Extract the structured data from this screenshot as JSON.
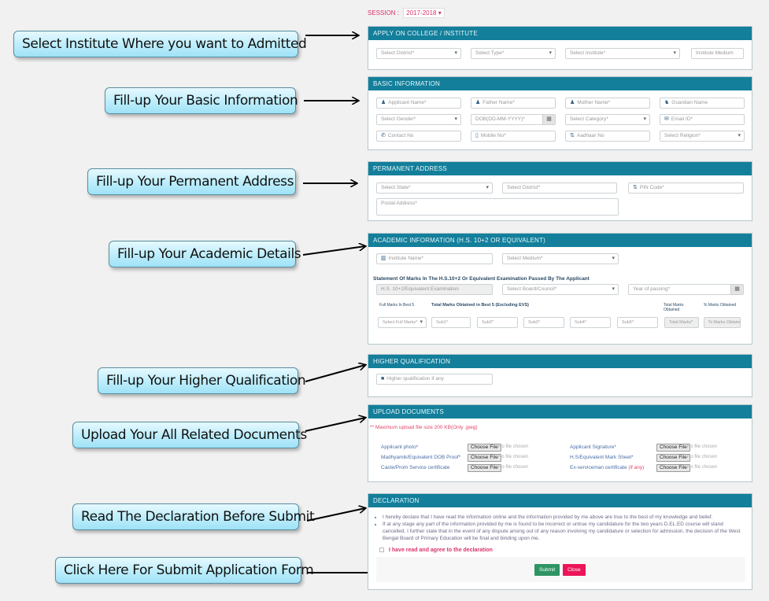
{
  "callouts": [
    "Select  Institute Where you want to Admitted",
    "Fill-up Your Basic Information",
    "Fill-up Your Permanent Address",
    "Fill-up Your Academic Details",
    "Fill-up Your Higher Qualification",
    "Upload Your All Related Documents",
    "Read The Declaration Before Submit",
    "Click Here For Submit Application Form"
  ],
  "session": {
    "label": "SESSION :",
    "value": "2017-2018"
  },
  "institute": {
    "title": "APPLY ON COLLEGE / INSTITUTE",
    "district": "Select District*",
    "type": "Select Type*",
    "institute": "Select Institute*",
    "medium": "Institute Medium"
  },
  "basic": {
    "title": "BASIC INFORMATION",
    "applicant_name": "Applicant Name*",
    "father_name": "Father Name*",
    "mother_name": "Mother Name*",
    "guardian_name": "Guardian Name",
    "gender": "Select Gender*",
    "dob": "DOB(DD-MM-YYYY)*",
    "category": "Select Category*",
    "email": "Email ID*",
    "contact": "Contact No",
    "mobile": "Mobile No*",
    "aadhaar": "Aadhaar No",
    "religion": "Select Religion*"
  },
  "address": {
    "title": "PERMANENT ADDRESS",
    "state": "Select State*",
    "district": "Select District*",
    "pin": "PIN Code*",
    "postal": "Postal Address*"
  },
  "academic": {
    "title": "ACADEMIC INFORMATION (H.S. 10+2 OR EQUIVALENT)",
    "institute_name": "Institute Name*",
    "medium": "Select Medium*",
    "statement": "Statement Of Marks In The H.S.10+2 Or Equivalent Examination Passed By The Applicant",
    "exam": "H.S. 10+2/Equivalent Examination",
    "board": "Select Board/Council*",
    "year": "Year of passing*",
    "col_full_marks": "Full Marks In Best 5",
    "col_obtained": "Total Marks Obtained in Best 5 (Excluding EVS)",
    "col_total": "Total Marks Obtained",
    "col_percent": "% Marks Obtained",
    "full_marks_select": "Select Full Marks*",
    "subjects": [
      "Sub1*",
      "Sub2*",
      "Sub3*",
      "Sub4*",
      "Sub5*"
    ],
    "total_placeholder": "Total Marks*",
    "percent_placeholder": "% Marks Obtained"
  },
  "higher": {
    "title": "HIGHER QUALIFICATION",
    "placeholder": "Higher qualification if any"
  },
  "upload": {
    "title": "UPLOAD DOCUMENTS",
    "note": "** Maximum upload file size 200 KB(Only .jpeg)",
    "choose_label": "Choose File",
    "no_file": "No file chosen",
    "docs": [
      {
        "label": "Applicant photo*",
        "extra": ""
      },
      {
        "label": "Applicant Signature*",
        "extra": ""
      },
      {
        "label": "Madhyamik/Equivalent DOB Proof*",
        "extra": ""
      },
      {
        "label": "H.S/Equivalent Mark Sheet*",
        "extra": ""
      },
      {
        "label": "Caste/Prom Service certificate",
        "extra": ""
      },
      {
        "label": "Ex-serviceman certificate",
        "extra": "(if any)"
      }
    ]
  },
  "declaration": {
    "title": "DECLARATION",
    "points": [
      "I hereby declare that I have read the information online and the information provided by me above are true to the best of my knowledge and belief.",
      "If at any stage any part of the information provided by me is found to be incorrect or untrue my candidature for the two years D.EL.ED course will stand cancelled. I further state that in the event of any dispute arising out of any reason involving my candidature or selection for admission, the decision of the West Bengal Board of Primary Education will be final and binding upon me."
    ],
    "agree": "I have read and agree to the declaration",
    "submit": "Submit",
    "close": "Close"
  }
}
